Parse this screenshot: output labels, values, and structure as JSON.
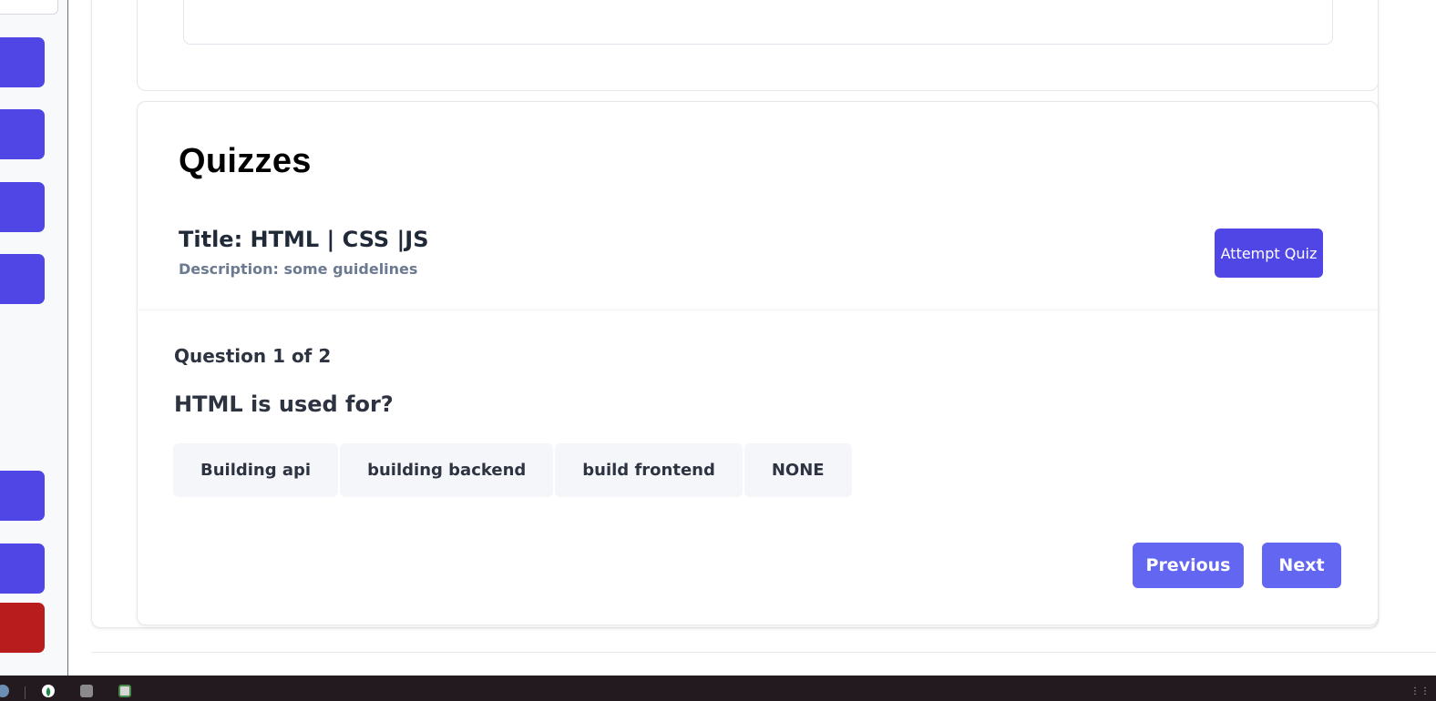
{
  "quizzes_section": {
    "heading": "Quizzes",
    "quiz": {
      "title": "Title: HTML | CSS |JS",
      "description": "Description: some guidelines",
      "attempt_label": "Attempt Quiz"
    }
  },
  "question": {
    "counter": "Question 1 of 2",
    "text": "HTML is used for?",
    "options": [
      "Building api",
      "building backend",
      "build frontend",
      "NONE"
    ]
  },
  "navigation": {
    "previous_label": "Previous",
    "next_label": "Next"
  },
  "colors": {
    "primary": "#4f46e5",
    "nav_button": "#6366f1",
    "danger": "#b91c1c",
    "taskbar": "#231a1f"
  },
  "icons": {
    "sidebar_buttons": [
      "sidebar-button",
      "sidebar-button",
      "sidebar-button",
      "sidebar-button",
      "sidebar-button",
      "sidebar-button",
      "logout-button"
    ],
    "taskbar": [
      "app-icon",
      "leaf-icon",
      "file-icon",
      "document-icon",
      "apps-grid-icon"
    ]
  }
}
